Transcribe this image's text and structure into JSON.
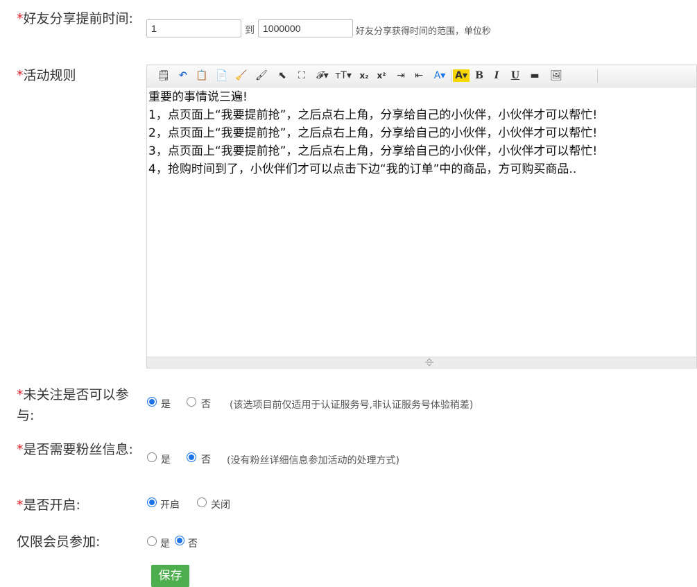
{
  "share_time": {
    "label": "好友分享提前时间:",
    "required_mark": "*",
    "from_value": "1",
    "to_text": "到",
    "to_value": "1000000",
    "hint": "好友分享获得时间的范围，单位秒"
  },
  "rules": {
    "label": "活动规则",
    "required_mark": "*",
    "toolbar": [
      {
        "name": "source-icon",
        "glyph": "🗒"
      },
      {
        "name": "undo-icon",
        "glyph": "↶"
      },
      {
        "name": "paste-text-icon",
        "glyph": "📋"
      },
      {
        "name": "paste-word-icon",
        "glyph": "📄"
      },
      {
        "name": "clear-format-icon",
        "glyph": "🧹"
      },
      {
        "name": "format-painter-icon",
        "glyph": "🖌"
      },
      {
        "name": "select-icon",
        "glyph": "⬉"
      },
      {
        "name": "fullscreen-icon",
        "glyph": "⛶"
      },
      {
        "name": "font-family-icon",
        "glyph": "𝓕▾"
      },
      {
        "name": "font-size-icon",
        "glyph": "ᴛT▾"
      },
      {
        "name": "subscript-icon",
        "glyph": "x₂"
      },
      {
        "name": "superscript-icon",
        "glyph": "x²"
      },
      {
        "name": "indent-icon",
        "glyph": "⇥"
      },
      {
        "name": "outdent-icon",
        "glyph": "⇤"
      },
      {
        "name": "font-color-icon",
        "glyph": "A▾"
      },
      {
        "name": "background-color-icon",
        "glyph": "A▾"
      },
      {
        "name": "bold-icon",
        "glyph": "B"
      },
      {
        "name": "italic-icon",
        "glyph": "I"
      },
      {
        "name": "underline-icon",
        "glyph": "U"
      },
      {
        "name": "insert-line-icon",
        "glyph": "▬"
      },
      {
        "name": "insert-image-icon",
        "glyph": "🖼"
      }
    ],
    "content": [
      "重要的事情说三遍!",
      "1，点页面上“我要提前抢”，之后点右上角，分享给自己的小伙伴，小伙伴才可以帮忙!",
      "2，点页面上“我要提前抢”，之后点右上角，分享给自己的小伙伴，小伙伴才可以帮忙!",
      "3，点页面上“我要提前抢”，之后点右上角，分享给自己的小伙伴，小伙伴才可以帮忙!",
      "4，抢购时间到了，小伙伴们才可以点击下边“我的订单”中的商品，方可购买商品.."
    ]
  },
  "follow_required": {
    "label": "未关注是否可以参与:",
    "required_mark": "*",
    "options": [
      "是",
      "否"
    ],
    "selected": "是",
    "note": "(该选项目前仅适用于认证服务号,非认证服务号体验稍差)"
  },
  "fan_info": {
    "label": "是否需要粉丝信息:",
    "required_mark": "*",
    "options": [
      "是",
      "否"
    ],
    "selected": "否",
    "note": "(没有粉丝详细信息参加活动的处理方式)"
  },
  "enabled": {
    "label": "是否开启:",
    "required_mark": "*",
    "options": [
      "开启",
      "关闭"
    ],
    "selected": "开启"
  },
  "members_only": {
    "label": "仅限会员参加:",
    "options": [
      "是",
      "否"
    ],
    "selected": "否"
  },
  "save_label": "保存",
  "colors": {
    "required": "#e0242b",
    "radio_selected": "#1a73e8",
    "save_button": "#4cae4c"
  }
}
